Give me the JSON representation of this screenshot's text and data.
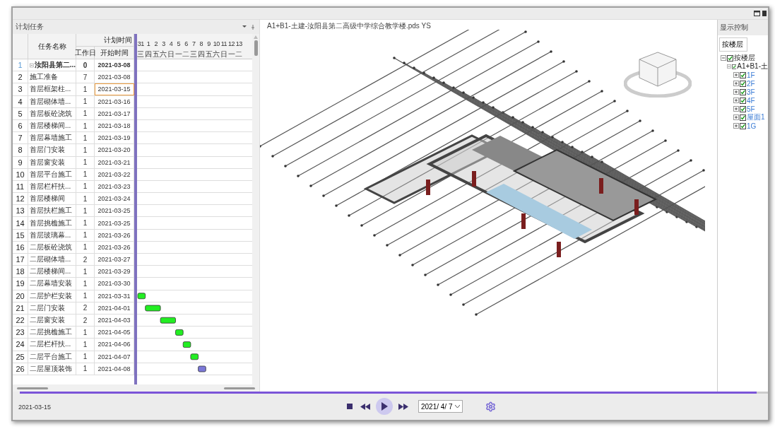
{
  "task_panel": {
    "title": "计划任务"
  },
  "table": {
    "columns": {
      "name": "任务名称",
      "group": "计划时间",
      "days": "工作日",
      "start": "开始时间"
    },
    "rows": [
      {
        "num": "1",
        "name": "汝阳县第二...",
        "days": "0",
        "start": "2021-03-08",
        "kind": "summary",
        "selected": false
      },
      {
        "num": "2",
        "name": "施工准备",
        "days": "7",
        "start": "2021-03-08",
        "kind": "task",
        "selected": false
      },
      {
        "num": "3",
        "name": "首层框架柱...",
        "days": "1",
        "start": "2021-03-15",
        "kind": "task",
        "selected": true
      },
      {
        "num": "4",
        "name": "首层砌体墙...",
        "days": "1",
        "start": "2021-03-16",
        "kind": "task",
        "selected": false
      },
      {
        "num": "5",
        "name": "首层板砼浇筑",
        "days": "1",
        "start": "2021-03-17",
        "kind": "task",
        "selected": false
      },
      {
        "num": "6",
        "name": "首层楼梯间...",
        "days": "1",
        "start": "2021-03-18",
        "kind": "task",
        "selected": false
      },
      {
        "num": "7",
        "name": "首层幕墙施工",
        "days": "1",
        "start": "2021-03-19",
        "kind": "task",
        "selected": false
      },
      {
        "num": "8",
        "name": "首层门安装",
        "days": "1",
        "start": "2021-03-20",
        "kind": "task",
        "selected": false
      },
      {
        "num": "9",
        "name": "首层窗安装",
        "days": "1",
        "start": "2021-03-21",
        "kind": "task",
        "selected": false
      },
      {
        "num": "10",
        "name": "首层平台施工",
        "days": "1",
        "start": "2021-03-22",
        "kind": "task",
        "selected": false
      },
      {
        "num": "11",
        "name": "首层栏杆扶...",
        "days": "1",
        "start": "2021-03-23",
        "kind": "task",
        "selected": false
      },
      {
        "num": "12",
        "name": "首层楼梯间",
        "days": "1",
        "start": "2021-03-24",
        "kind": "task",
        "selected": false
      },
      {
        "num": "13",
        "name": "首层扶栏施工",
        "days": "1",
        "start": "2021-03-25",
        "kind": "task",
        "selected": false
      },
      {
        "num": "14",
        "name": "首层挑檐施工",
        "days": "1",
        "start": "2021-03-25",
        "kind": "task",
        "selected": false
      },
      {
        "num": "15",
        "name": "首层玻璃幕...",
        "days": "1",
        "start": "2021-03-26",
        "kind": "task",
        "selected": false
      },
      {
        "num": "16",
        "name": "二层板砼浇筑",
        "days": "1",
        "start": "2021-03-26",
        "kind": "task",
        "selected": false
      },
      {
        "num": "17",
        "name": "二层砌体墙...",
        "days": "2",
        "start": "2021-03-27",
        "kind": "task",
        "selected": false
      },
      {
        "num": "18",
        "name": "二层楼梯间...",
        "days": "1",
        "start": "2021-03-29",
        "kind": "task",
        "selected": false
      },
      {
        "num": "19",
        "name": "二层幕墙安装",
        "days": "1",
        "start": "2021-03-30",
        "kind": "task",
        "selected": false
      },
      {
        "num": "20",
        "name": "二层护栏安装",
        "days": "1",
        "start": "2021-03-31",
        "kind": "task",
        "selected": false,
        "bar_visible": true,
        "bar_active": false
      },
      {
        "num": "21",
        "name": "二层门安装",
        "days": "2",
        "start": "2021-04-01",
        "kind": "task",
        "selected": false,
        "bar_visible": true,
        "bar_active": false
      },
      {
        "num": "22",
        "name": "二层窗安装",
        "days": "2",
        "start": "2021-04-03",
        "kind": "task",
        "selected": false,
        "bar_visible": true,
        "bar_active": false
      },
      {
        "num": "23",
        "name": "二层挑檐施工",
        "days": "1",
        "start": "2021-04-05",
        "kind": "task",
        "selected": false,
        "bar_visible": true,
        "bar_active": false
      },
      {
        "num": "24",
        "name": "二层栏杆扶...",
        "days": "1",
        "start": "2021-04-06",
        "kind": "task",
        "selected": false,
        "bar_visible": true,
        "bar_active": false
      },
      {
        "num": "25",
        "name": "二层平台施工",
        "days": "1",
        "start": "2021-04-07",
        "kind": "task",
        "selected": false,
        "bar_visible": true,
        "bar_active": false
      },
      {
        "num": "26",
        "name": "二层屋顶装饰",
        "days": "1",
        "start": "2021-04-08",
        "kind": "task",
        "selected": false,
        "bar_visible": true,
        "bar_active": true
      }
    ]
  },
  "timeline": {
    "days": [
      {
        "date": "31",
        "weekday": "三"
      },
      {
        "date": "1",
        "weekday": "四"
      },
      {
        "date": "2",
        "weekday": "五"
      },
      {
        "date": "3",
        "weekday": "六"
      },
      {
        "date": "4",
        "weekday": "日"
      },
      {
        "date": "5",
        "weekday": "一"
      },
      {
        "date": "6",
        "weekday": "二"
      },
      {
        "date": "7",
        "weekday": "三"
      },
      {
        "date": "8",
        "weekday": "四"
      },
      {
        "date": "9",
        "weekday": "五"
      },
      {
        "date": "10",
        "weekday": "六"
      },
      {
        "date": "11",
        "weekday": "日"
      },
      {
        "date": "12",
        "weekday": "一"
      },
      {
        "date": "13",
        "weekday": "二"
      }
    ]
  },
  "viewport": {
    "title": "A1+B1-土建-汝阳县第二高级中学综合教学楼.pds YS"
  },
  "display_panel": {
    "title": "显示控制",
    "mode": "按楼层",
    "tree": [
      {
        "label": "按楼层",
        "checked": true,
        "expanded": true,
        "children": [
          {
            "label": "A1+B1-土",
            "checked": true,
            "expanded": true,
            "children": [
              {
                "label": "1F",
                "checked": true,
                "expanded": false
              },
              {
                "label": "2F",
                "checked": true,
                "expanded": false
              },
              {
                "label": "3F",
                "checked": true,
                "expanded": false
              },
              {
                "label": "4F",
                "checked": true,
                "expanded": false
              },
              {
                "label": "5F",
                "checked": true,
                "expanded": false
              },
              {
                "label": "屋面1",
                "checked": true,
                "expanded": false
              },
              {
                "label": "1G",
                "checked": true,
                "expanded": false
              }
            ]
          }
        ]
      }
    ]
  },
  "playback": {
    "current_date": "2021-03-15",
    "progress": {
      "level": 0.985
    },
    "date_value": "2021/ 4/ 7"
  }
}
